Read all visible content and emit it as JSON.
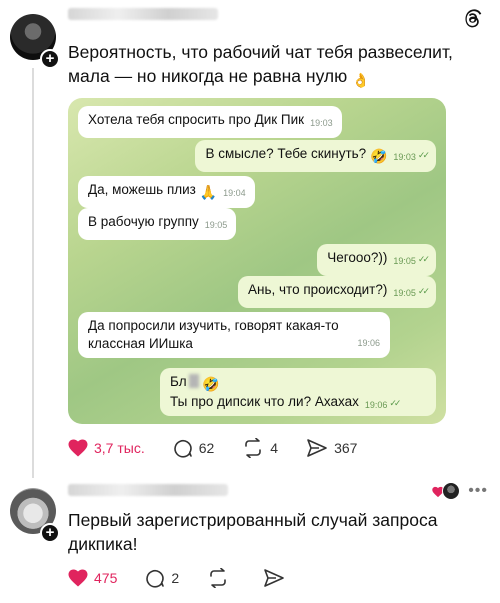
{
  "post": {
    "caption": "Вероятность, что рабочий чат тебя развеселит, мала — но никогда не равна нулю",
    "caption_emoji": "👌",
    "chat": [
      {
        "dir": "in",
        "text": "Хотела тебя спросить про Дик Пик",
        "time": "19:03"
      },
      {
        "dir": "out",
        "text": "В смысле? Тебе скинуть?",
        "emoji": "🤣",
        "time": "19:03",
        "ticks": "✓✓"
      },
      {
        "dir": "in",
        "text": "Да, можешь плиз",
        "emoji": "🙏",
        "time": "19:04"
      },
      {
        "dir": "in",
        "text": "В рабочую группу",
        "time": "19:05"
      },
      {
        "dir": "out",
        "text": "Чегооо?))",
        "time": "19:05",
        "ticks": "✓✓"
      },
      {
        "dir": "out",
        "text": "Ань, что происходит?)",
        "time": "19:05",
        "ticks": "✓✓"
      },
      {
        "dir": "in",
        "text": "Да попросили изучить, говорят какая-то классная ИИшка",
        "time": "19:06"
      },
      {
        "dir": "out",
        "text_line1": "Бл",
        "emoji": "🤣",
        "text_line2": "Ты про дипсик что ли? Ахахах",
        "time": "19:06",
        "ticks": "✓✓"
      }
    ],
    "actions": {
      "likes": "3,7 тыс.",
      "comments": "62",
      "reposts": "4",
      "shares": "367"
    }
  },
  "reply": {
    "caption": "Первый зарегистрированный случай запроса дикпика!",
    "actions": {
      "likes": "475",
      "comments": "2"
    },
    "more_label": "•••"
  },
  "colors": {
    "like": "#e0245e",
    "chat_bg": "#b9d58f",
    "bubble_out": "#eef7d5",
    "bubble_in": "#ffffff"
  },
  "icons": [
    "threads-logo-icon",
    "plus-icon",
    "heart-icon",
    "comment-icon",
    "repost-icon",
    "share-icon",
    "more-icon"
  ]
}
